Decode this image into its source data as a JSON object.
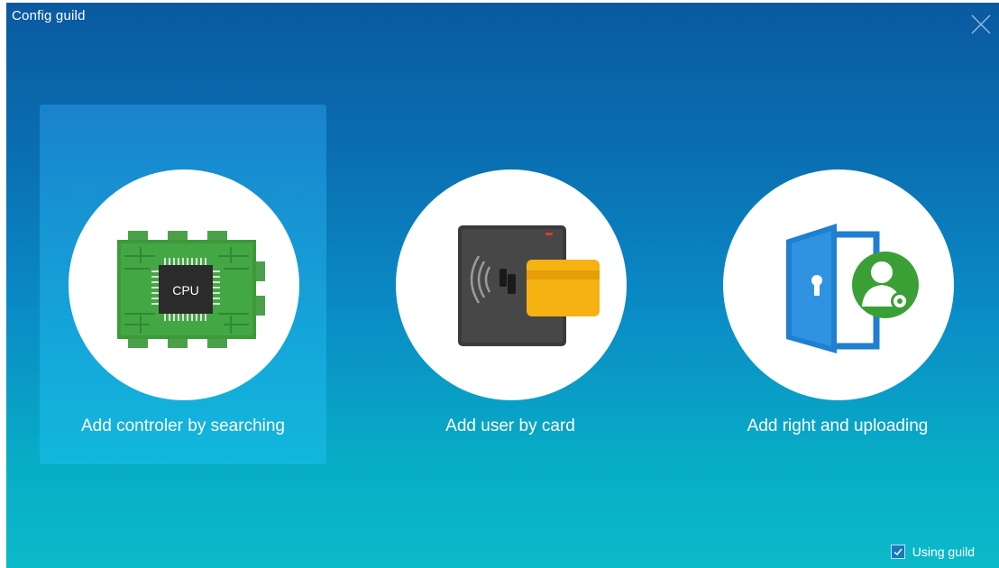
{
  "window": {
    "title": "Config guild"
  },
  "cards": [
    {
      "label": "Add controler by searching",
      "selected": true
    },
    {
      "label": "Add user by card",
      "selected": false
    },
    {
      "label": "Add right and uploading",
      "selected": false
    }
  ],
  "cpu_chip": {
    "text": "CPU"
  },
  "footer": {
    "using_guild_label": "Using guild",
    "using_guild_checked": true
  },
  "colors": {
    "background_top": "#0a5aa0",
    "background_bottom": "#0bbac8",
    "selected_card": "#1fa8dc",
    "pcb_green": "#3c9a3a",
    "card_yellow": "#f6b212",
    "door_blue": "#1f7fd0",
    "user_green": "#3aa036"
  }
}
